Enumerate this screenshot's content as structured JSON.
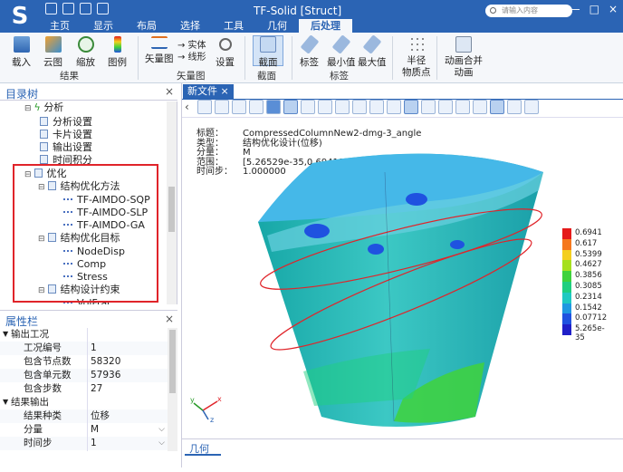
{
  "app": {
    "logo_letter": "S",
    "title": "TF-Solid [Struct]",
    "search_placeholder": "请输入内容"
  },
  "menu": [
    "主页",
    "显示",
    "布局",
    "选择",
    "工具",
    "几何",
    "后处理"
  ],
  "window_controls": [
    "?",
    "—",
    "□",
    "×"
  ],
  "ribbon": {
    "buttons": [
      "载入",
      "云图",
      "缩放",
      "图例",
      "矢量图",
      "设置",
      "截面",
      "标签",
      "最小值",
      "最大值",
      "半径\n物质点",
      "动画合并\n动画"
    ],
    "small": [
      "→ 实体",
      "→ 线形"
    ],
    "groups": [
      "结果",
      "矢量图",
      "截面",
      "标签"
    ]
  },
  "tree": {
    "title": "目录树",
    "nodes": [
      "分析",
      "分析设置",
      "卡片设置",
      "输出设置",
      "时间积分",
      "优化",
      "结构优化方法",
      "TF-AIMDO-SQP",
      "TF-AIMDO-SLP",
      "TF-AIMDO-GA",
      "结构优化目标",
      "NodeDisp",
      "Comp",
      "Stress",
      "结构设计约束",
      "VolFrac"
    ]
  },
  "props": {
    "title": "属性栏",
    "section1": "输出工况",
    "rows1": [
      [
        "工况编号",
        "1"
      ],
      [
        "包含节点数",
        "58320"
      ],
      [
        "包含单元数",
        "57936"
      ],
      [
        "包含步数",
        "27"
      ]
    ],
    "section2": "结果输出",
    "rows2": [
      [
        "结果种类",
        "位移"
      ],
      [
        "分量",
        "M"
      ],
      [
        "时间步",
        "1"
      ]
    ]
  },
  "doc": {
    "tab": "新文件",
    "bottom_tab": "几何"
  },
  "info": {
    "labels": [
      "标题：",
      "类型：",
      "分量：",
      "范围：",
      "时间步："
    ],
    "values": [
      "CompressedColumnNew2-dmg-3_angle",
      "结构优化设计(位移)",
      "M",
      "[5.26529e-35,0.694116]",
      "1.000000"
    ]
  },
  "legend": {
    "values": [
      "0.6941",
      "0.617",
      "0.5399",
      "0.4627",
      "0.3856",
      "0.3085",
      "0.2314",
      "0.1542",
      "0.07712",
      "5.265e-35"
    ],
    "colors": [
      "#e51a1a",
      "#f5781e",
      "#f4cf1f",
      "#a6e01e",
      "#3fd23c",
      "#1fcf7f",
      "#1fc9c1",
      "#1f98e1",
      "#1f52e0",
      "#1f1fc8"
    ]
  },
  "triad": {
    "x": "x",
    "y": "y",
    "z": "z"
  }
}
